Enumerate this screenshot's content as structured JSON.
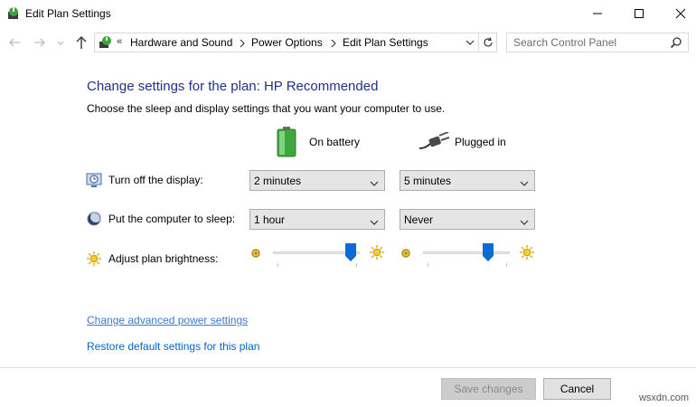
{
  "window": {
    "title": "Edit Plan Settings",
    "minimize_icon": "minimize-icon",
    "maximize_icon": "maximize-icon",
    "close_icon": "close-icon"
  },
  "navigation": {
    "overflow_chevron": "«",
    "breadcrumbs": [
      "Hardware and Sound",
      "Power Options",
      "Edit Plan Settings"
    ],
    "search_placeholder": "Search Control Panel"
  },
  "page": {
    "title": "Change settings for the plan: HP Recommended",
    "subtitle": "Choose the sleep and display settings that you want your computer to use."
  },
  "columns": {
    "battery": "On battery",
    "plugged": "Plugged in"
  },
  "settings": {
    "display": {
      "label": "Turn off the display:",
      "battery_value": "2 minutes",
      "plugged_value": "5 minutes"
    },
    "sleep": {
      "label": "Put the computer to sleep:",
      "battery_value": "1 hour",
      "plugged_value": "Never"
    },
    "brightness": {
      "label": "Adjust plan brightness:",
      "battery_level": 0.9,
      "plugged_level": 0.75
    }
  },
  "links": {
    "advanced": "Change advanced power settings",
    "restore": "Restore default settings for this plan"
  },
  "footer": {
    "save_label": "Save changes",
    "cancel_label": "Cancel",
    "watermark": "wsxdn.com"
  },
  "colors": {
    "title_blue": "#1e3287",
    "link_blue": "#0066cc",
    "slider_thumb": "#0b6cd4"
  }
}
